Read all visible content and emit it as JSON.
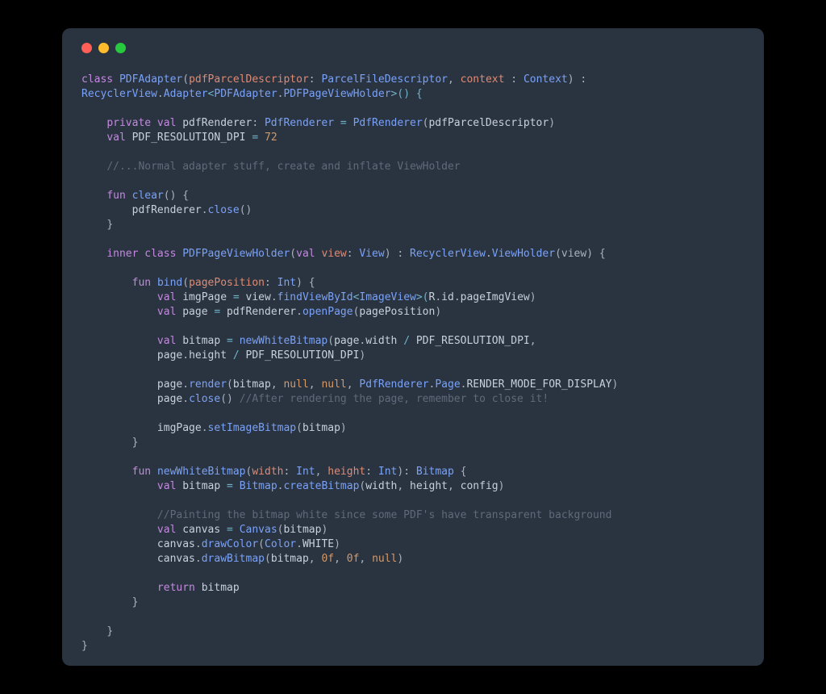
{
  "traffic": {
    "red": "#ff5f56",
    "yellow": "#ffbd2e",
    "green": "#27c93f"
  },
  "code": {
    "l1": {
      "class": "class ",
      "name": "PDFAdapter",
      "open": "(",
      "p1": "pdfParcelDescriptor",
      "c1": ": ",
      "t1": "ParcelFileDescriptor",
      "comma": ", ",
      "p2": "context ",
      "c2": ": ",
      "t2": "Context",
      "close": ") :"
    },
    "l2": {
      "a": "RecyclerView",
      "dot": ".",
      "b": "Adapter",
      "lt": "<",
      "c": "PDFAdapter",
      "dot2": ".",
      "d": "PDFPageViewHolder",
      "gt": ">() {"
    },
    "l3": {
      "kw": "private val ",
      "name": "pdfRenderer",
      "c": ": ",
      "t": "PdfRenderer",
      "eq": " = ",
      "call": "PdfRenderer",
      "open": "(",
      "arg": "pdfParcelDescriptor",
      "close": ")"
    },
    "l4": {
      "kw": "val ",
      "name": "PDF_RESOLUTION_DPI",
      "eq": " = ",
      "val": "72"
    },
    "l5": {
      "c": "//...Normal adapter stuff, create and inflate ViewHolder"
    },
    "l6": {
      "kw": "fun ",
      "name": "clear",
      "sig": "() {"
    },
    "l7": {
      "obj": "pdfRenderer",
      "dot": ".",
      "fn": "close",
      "p": "()"
    },
    "l8": {
      "brace": "}"
    },
    "l9": {
      "kw": "inner class ",
      "name": "PDFPageViewHolder",
      "open": "(",
      "pkw": "val ",
      "pn": "view",
      "c": ": ",
      "pt": "View",
      "close": ") : ",
      "sup": "RecyclerView",
      "dot": ".",
      "sup2": "ViewHolder",
      "args": "(view) {"
    },
    "l10": {
      "kw": "fun ",
      "name": "bind",
      "open": "(",
      "p": "pagePosition",
      "c": ": ",
      "t": "Int",
      "close": ") {"
    },
    "l11": {
      "kw": "val ",
      "n": "imgPage",
      "eq": " = ",
      "o": "view",
      "dot": ".",
      "fn": "findViewById",
      "lt": "<",
      "ty": "ImageView",
      "gt": ">(",
      "r": "R",
      "d2": ".",
      "id": "id",
      "d3": ".",
      "pv": "pageImgView",
      "close": ")"
    },
    "l12": {
      "kw": "val ",
      "n": "page",
      "eq": " = ",
      "o": "pdfRenderer",
      "dot": ".",
      "fn": "openPage",
      "open": "(",
      "arg": "pagePosition",
      "close": ")"
    },
    "l13": {
      "kw": "val ",
      "n": "bitmap",
      "eq": " = ",
      "fn": "newWhiteBitmap",
      "open": "(",
      "o": "page",
      "dot": ".",
      "p": "width",
      "op": " / ",
      "c": "PDF_RESOLUTION_DPI",
      "comma": ","
    },
    "l14": {
      "o": "page",
      "dot": ".",
      "p": "height",
      "op": " / ",
      "c": "PDF_RESOLUTION_DPI",
      "close": ")"
    },
    "l15": {
      "o": "page",
      "dot": ".",
      "fn": "render",
      "open": "(",
      "a1": "bitmap",
      "c1": ", ",
      "n1": "null",
      "c2": ", ",
      "n2": "null",
      "c3": ", ",
      "r": "PdfRenderer",
      "d": ".",
      "pg": "Page",
      "d2": ".",
      "mode": "RENDER_MODE_FOR_DISPLAY",
      "close": ")"
    },
    "l16": {
      "o": "page",
      "dot": ".",
      "fn": "close",
      "p": "() ",
      "com": "//After rendering the page, remember to close it!"
    },
    "l17": {
      "o": "imgPage",
      "dot": ".",
      "fn": "setImageBitmap",
      "open": "(",
      "a": "bitmap",
      "close": ")"
    },
    "l18": {
      "brace": "}"
    },
    "l19": {
      "kw": "fun ",
      "name": "newWhiteBitmap",
      "open": "(",
      "p1": "width",
      "c1": ": ",
      "t1": "Int",
      "comma": ", ",
      "p2": "height",
      "c2": ": ",
      "t2": "Int",
      "close": "): ",
      "rt": "Bitmap",
      "brace": " {"
    },
    "l20": {
      "kw": "val ",
      "n": "bitmap",
      "eq": " = ",
      "o": "Bitmap",
      "dot": ".",
      "fn": "createBitmap",
      "open": "(",
      "a1": "width",
      "c1": ", ",
      "a2": "height",
      "c2": ", ",
      "a3": "config",
      "close": ")"
    },
    "l21": {
      "com": "//Painting the bitmap white since some PDF's have transparent background"
    },
    "l22": {
      "kw": "val ",
      "n": "canvas",
      "eq": " = ",
      "fn": "Canvas",
      "open": "(",
      "a": "bitmap",
      "close": ")"
    },
    "l23": {
      "o": "canvas",
      "dot": ".",
      "fn": "drawColor",
      "open": "(",
      "c": "Color",
      "d": ".",
      "w": "WHITE",
      "close": ")"
    },
    "l24": {
      "o": "canvas",
      "dot": ".",
      "fn": "drawBitmap",
      "open": "(",
      "a1": "bitmap",
      "c1": ", ",
      "z1": "0f",
      "c2": ", ",
      "z2": "0f",
      "c3": ", ",
      "n": "null",
      "close": ")"
    },
    "l25": {
      "kw": "return ",
      "v": "bitmap"
    },
    "l26": {
      "brace": "}"
    },
    "l27": {
      "brace": "}"
    },
    "l28": {
      "brace": "}"
    }
  }
}
